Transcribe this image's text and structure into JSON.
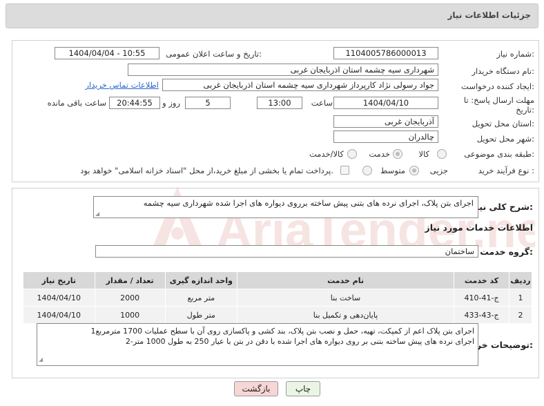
{
  "header": {
    "title": "جزئیات اطلاعات نیاز"
  },
  "form": {
    "need_number_label": "شماره نیاز:",
    "need_number": "1104005786000013",
    "announce_label": "تاریخ و ساعت اعلان عمومی:",
    "announce_value": "1404/04/04 - 10:55",
    "buyer_org_label": "نام دستگاه خریدار:",
    "buyer_org": "شهرداری سیه چشمه استان اذربایجان غربی",
    "creator_label": "ایجاد کننده درخواست:",
    "creator": "جواد رسولی نژاد کارپرداز شهرداری سیه چشمه استان اذربایجان غربی",
    "contact_link": "اطلاعات تماس خریدار",
    "deadline_label_1": "مهلت ارسال پاسخ: تا",
    "deadline_label_2": "تاریخ:",
    "deadline_date": "1404/04/10",
    "time_label": "ساعت",
    "deadline_time": "13:00",
    "days_value": "5",
    "days_label": "روز و",
    "remaining_value": "20:44:55",
    "remaining_label": "ساعت باقی مانده",
    "province_label": "استان محل تحویل:",
    "province": "آذربایجان غربی",
    "city_label": "شهر محل تحویل:",
    "city": "چالدران",
    "category_label": "طبقه بندی موضوعی:",
    "category_options": [
      "کالا",
      "خدمت",
      "کالا/خدمت"
    ],
    "category_selected": "خدمت",
    "process_label": "نوع فرآیند خرید :",
    "process_options": [
      "جزیی",
      "متوسط"
    ],
    "process_selected": "جزیی",
    "payment_note": "پرداخت تمام یا بخشی از مبلغ خرید،از محل \"اسناد خزانه اسلامی\" خواهد بود."
  },
  "summary": {
    "label": "شرح کلی نیاز:",
    "text": "اجرای بتن پلاک، اجرای نرده های بتنی پیش ساخته برروی دیواره های اجرا شده شهرداری سیه چشمه"
  },
  "services": {
    "section_title": "اطلاعات خدمات مورد نیاز",
    "group_label": "گروه خدمت:",
    "group_value": "ساختمان",
    "columns": [
      "ردیف",
      "کد خدمت",
      "نام خدمت",
      "واحد اندازه گیری",
      "تعداد / مقدار",
      "تاریخ نیاز"
    ],
    "rows": [
      [
        "1",
        "ج-41-410",
        "ساخت بنا",
        "متر مربع",
        "2000",
        "1404/04/10"
      ],
      [
        "2",
        "ج-43-433",
        "پایان‌دهی و تکمیل بنا",
        "متر طول",
        "1000",
        "1404/04/10"
      ]
    ]
  },
  "buyer_notes": {
    "label": "توضیحات خریدار:",
    "line1": "1اجرای بتن پلاک اعم از کمپکت، تهیه، حمل و نصب بتن پلاک، بند کشی و پاکسازی روی آن با سطح عملیات 1700 مترمربع",
    "line2": "2-اجرای نرده های پیش ساخته بتنی بر روی دیواره های اجرا شده با دقن در بتن با عیار 250 به طول 1000 متر"
  },
  "buttons": {
    "print": "چاپ",
    "back": "بازگشت"
  },
  "colors": {
    "back_button_bg": "#f7d6d6",
    "print_button_bg": "#eaf5e6",
    "link": "#2a66c9",
    "watermark": "#c0392b"
  },
  "watermark": {
    "text": "AriaTender.neT"
  }
}
